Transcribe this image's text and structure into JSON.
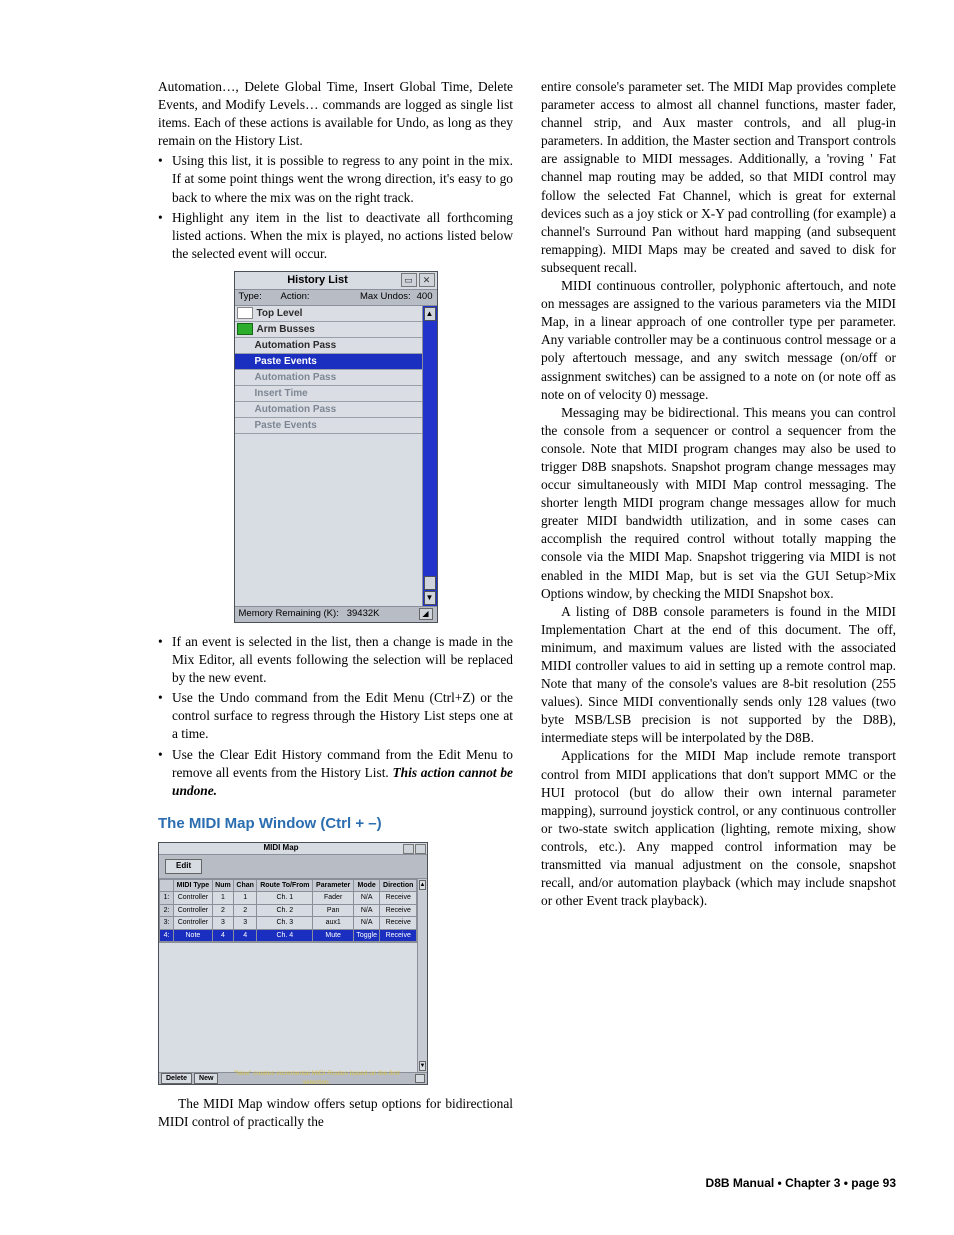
{
  "left": {
    "intro": "Automation…, Delete Global Time, Insert Global Time, Delete Events, and Modify Levels… commands are logged as single list items. Each of these actions is available for Undo, as long as they remain on the History List.",
    "bul1": "Using this list, it is possible to regress to any point in the mix. If at some point things went the wrong direction, it's easy to go back to where the mix was on the right track.",
    "bul2": "Highlight any item in the list to deactivate all forthcoming listed actions. When the mix is played, no actions listed below the selected event will occur.",
    "bul3": "If an event is selected in the list, then a change is made in the Mix Editor, all events following the selection will be replaced by the new event.",
    "bul4": "Use the Undo command from the Edit Menu (Ctrl+Z) or the control surface to regress through the History List steps one at a time.",
    "bul5_a": "Use the Clear Edit History command from the Edit Menu to remove all events from the History List. ",
    "bul5_b": "This action cannot be undone.",
    "heading": "The MIDI Map Window (Ctrl + –)",
    "midi_intro": "The MIDI Map window offers setup options for bidirectional MIDI control of practically the"
  },
  "history": {
    "title": "History List",
    "type_label": "Type:",
    "action_label": "Action:",
    "max_undos_label": "Max Undos:",
    "max_undos_value": "400",
    "rows": {
      "r0": "Top Level",
      "r1": "Arm Busses",
      "r2": "Automation Pass",
      "r3": "Paste Events",
      "r4": "Automation Pass",
      "r5": "Insert Time",
      "r6": "Automation Pass",
      "r7": "Paste Events"
    },
    "memory_label": "Memory Remaining (K):",
    "memory_value": "39432K"
  },
  "midi": {
    "title": "MIDI Map",
    "edit": "Edit",
    "headers": {
      "h1": "MIDI Type",
      "h2": "Num",
      "h3": "Chan",
      "h4": "Route To/From",
      "h5": "Parameter",
      "h6": "Mode",
      "h7": "Direction"
    },
    "rows": {
      "r1": {
        "i": "1:",
        "a": "Controller",
        "b": "1",
        "c": "1",
        "d": "Ch. 1",
        "e": "Fader",
        "f": "N/A",
        "g": "Receive"
      },
      "r2": {
        "i": "2:",
        "a": "Controller",
        "b": "2",
        "c": "2",
        "d": "Ch. 2",
        "e": "Pan",
        "f": "N/A",
        "g": "Receive"
      },
      "r3": {
        "i": "3:",
        "a": "Controller",
        "b": "3",
        "c": "3",
        "d": "Ch. 3",
        "e": "aux1",
        "f": "N/A",
        "g": "Receive"
      },
      "r4": {
        "i": "4:",
        "a": "Note",
        "b": "4",
        "c": "4",
        "d": "Ch. 4",
        "e": "Mute",
        "f": "Toggle",
        "g": "Receive"
      }
    },
    "delete": "Delete",
    "new": "New",
    "hint": "\"New\" creates incremental MIDI Routes based on the first selection."
  },
  "right": {
    "p1": "entire console's parameter set. The MIDI Map provides complete parameter access to almost all channel functions, master fader, channel strip, and Aux master controls, and all plug-in parameters. In addition, the Master section and Transport controls are assignable to MIDI messages. Additionally, a 'roving ' Fat channel map routing may be added, so that MIDI control may follow the selected Fat Channel, which is great for external devices such as a joy stick or X-Y pad controlling (for example) a channel's Surround Pan without hard mapping (and subsequent remapping). MIDI Maps may be created and saved to disk for subsequent recall.",
    "p2": "MIDI continuous controller, polyphonic aftertouch, and note on messages are assigned to the various parameters via the MIDI Map, in a linear approach of one controller type per parameter. Any variable controller may be a continuous control message or a poly aftertouch message, and any switch message (on/off or assignment switches) can be assigned to a note on (or note off as note on of velocity 0) message.",
    "p3": "Messaging may be bidirectional. This means you can control the console from a sequencer or control a sequencer from the console. Note that MIDI program changes may also be used to trigger D8B snapshots. Snapshot program change messages may occur simultaneously with MIDI Map control messaging. The shorter length MIDI program change messages allow for much greater MIDI bandwidth utilization, and in some cases can accomplish the required control without totally mapping the console via the MIDI Map. Snapshot triggering via MIDI is not enabled in the MIDI Map, but is set via the GUI Setup>Mix Options window, by checking the MIDI Snapshot box.",
    "p4": "A listing of D8B console parameters is found in the MIDI Implementation Chart at the end of this document. The off, minimum, and maximum values are listed with the associated MIDI controller values to aid in setting up a remote control map. Note that many of the console's values are 8-bit resolution (255 values). Since MIDI conventionally sends only 128 values (two byte MSB/LSB precision is not supported by the D8B), intermediate steps will be interpolated by the D8B.",
    "p5": "Applications for the MIDI Map include remote transport control from MIDI applications that don't support MMC or the HUI protocol (but do allow their own internal parameter mapping), surround joystick control, or any continuous controller or two-state switch application (lighting, remote mixing, show controls, etc.). Any mapped control information may be transmitted via manual adjustment on the console, snapshot recall, and/or automation playback (which may include snapshot or other Event track playback)."
  },
  "footer": "D8B Manual • Chapter 3 • page  93"
}
